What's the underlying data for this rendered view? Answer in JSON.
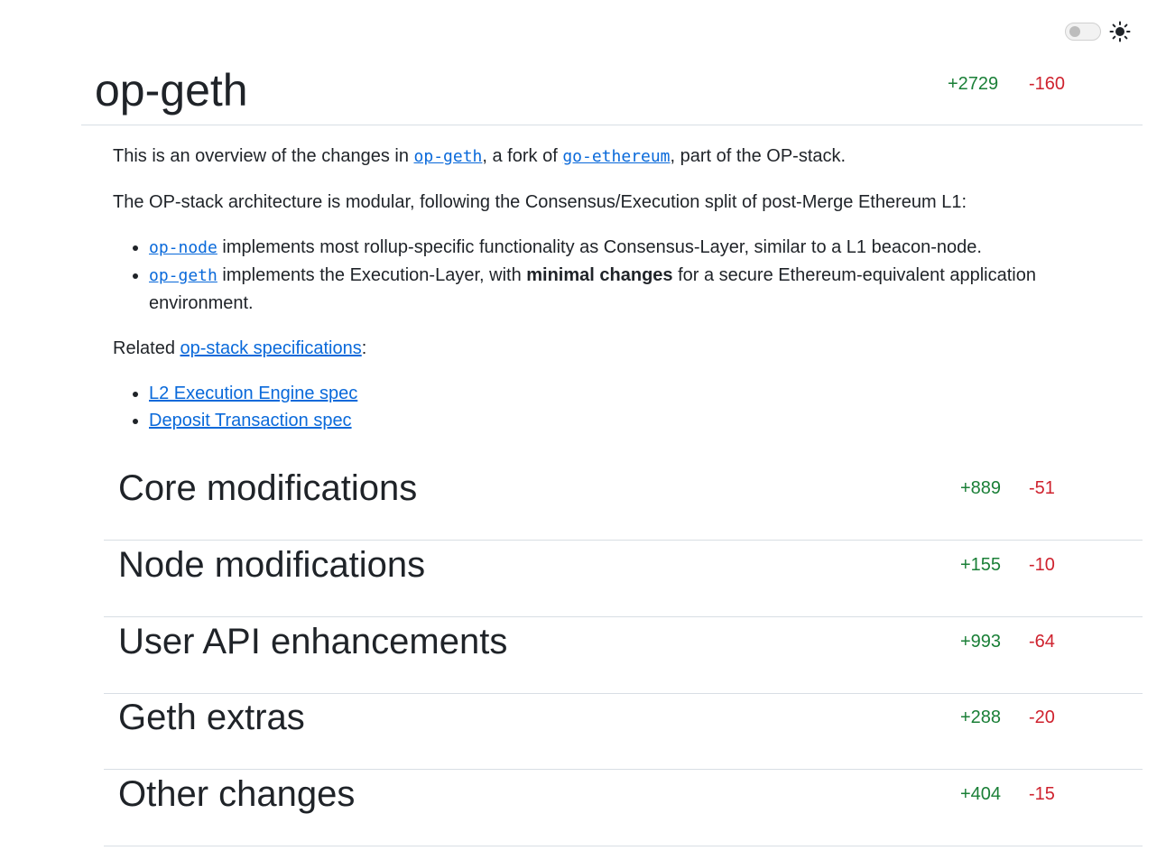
{
  "header": {
    "title": "op-geth",
    "additions": "+2729",
    "deletions": "-160",
    "theme_icon": "sun-icon"
  },
  "intro": {
    "line1_before": "This is an overview of the changes in ",
    "line1_link1": "op-geth",
    "line1_mid": ", a fork of ",
    "line1_link2": "go-ethereum",
    "line1_after": ", part of the OP-stack.",
    "line2": "The OP-stack architecture is modular, following the Consensus/Execution split of post-Merge Ethereum L1:",
    "bullet1_link": "op-node",
    "bullet1_text": " implements most rollup-specific functionality as Consensus-Layer, similar to a L1 beacon-node.",
    "bullet2_link": "op-geth",
    "bullet2_text_before": " implements the Execution-Layer, with ",
    "bullet2_bold": "minimal changes",
    "bullet2_text_after": " for a secure Ethereum-equivalent application environment.",
    "related_before": "Related ",
    "related_link": "op-stack specifications",
    "related_after": ":",
    "spec_link1": "L2 Execution Engine spec",
    "spec_link2": "Deposit Transaction spec"
  },
  "sections": [
    {
      "title": "Core modifications",
      "additions": "+889",
      "deletions": "-51"
    },
    {
      "title": "Node modifications",
      "additions": "+155",
      "deletions": "-10"
    },
    {
      "title": "User API enhancements",
      "additions": "+993",
      "deletions": "-64"
    },
    {
      "title": "Geth extras",
      "additions": "+288",
      "deletions": "-20"
    },
    {
      "title": "Other changes",
      "additions": "+404",
      "deletions": "-15"
    }
  ]
}
